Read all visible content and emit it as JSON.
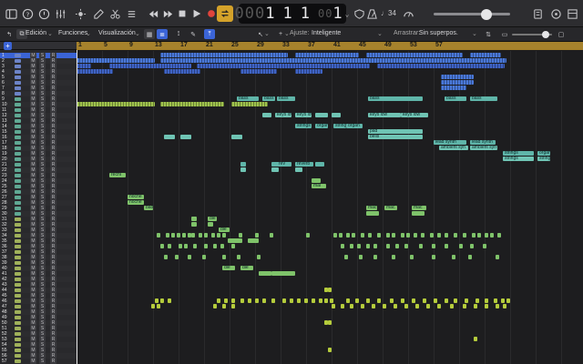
{
  "control_bar": {
    "lcd_bars": "1",
    "lcd_beats": "1",
    "lcd_div": "1",
    "lcd_ticks": "1",
    "lcd_dim_prefix": "000",
    "tempo_label": "♩34",
    "colors": {
      "cycle": "#d4a22a",
      "record": "#e0443c"
    }
  },
  "toolbar": {
    "edit_menu": "Edición",
    "functions_menu": "Funciones",
    "view_menu": "Visualización",
    "snap_label": "Ajuste:",
    "snap_value": "Inteligente",
    "drag_label": "Arrastrar:",
    "drag_value": "Sin superpos."
  },
  "ruler": {
    "bars": [
      "1",
      "5",
      "9",
      "13",
      "17",
      "21",
      "25",
      "29",
      "33",
      "37",
      "41",
      "45",
      "49",
      "53",
      "57"
    ]
  },
  "track_header": {
    "add_track_label": "+",
    "mute_label": "M",
    "solo_label": "S",
    "rec_label": "R",
    "track_numbers": [
      "1",
      "2",
      "3",
      "4",
      "5",
      "6",
      "7",
      "8",
      "9",
      "10",
      "11",
      "12",
      "13",
      "14",
      "15",
      "16",
      "17",
      "18",
      "19",
      "20",
      "21",
      "22",
      "23",
      "24",
      "25",
      "26",
      "27",
      "28",
      "29",
      "30",
      "31",
      "32",
      "33",
      "34",
      "35",
      "36",
      "37",
      "38",
      "39",
      "40",
      "41",
      "42",
      "43",
      "44",
      "45",
      "46",
      "47",
      "48",
      "49",
      "50",
      "51",
      "52",
      "53",
      "54",
      "55",
      "56",
      "57"
    ]
  },
  "region_labels": {
    "bass": "bass",
    "keys_low": "keys low",
    "strings": "strings",
    "organ": "organ",
    "pad": "pad",
    "bells": "bells",
    "lead_synth": "lead synth",
    "ambient_syn": "ambient syn",
    "strum": "strum",
    "rev": "rev",
    "reverb": "reverb",
    "mal": "mal",
    "rechi": "rechi",
    "noche": "noche",
    "bad": "bad",
    "mac": "mac",
    "dle": "dle"
  }
}
